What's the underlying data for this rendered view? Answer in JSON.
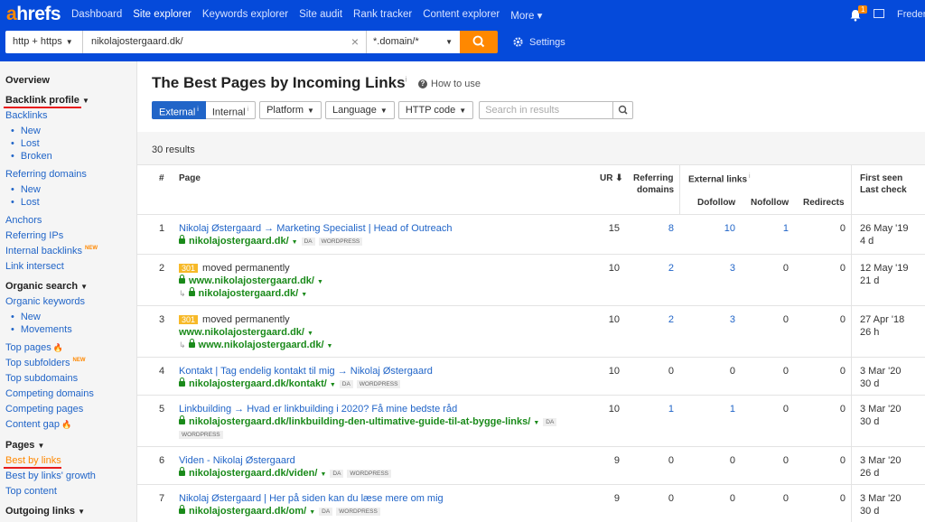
{
  "topbar": {
    "logo_a": "a",
    "logo_rest": "hrefs",
    "nav": [
      "Dashboard",
      "Site explorer",
      "Keywords explorer",
      "Site audit",
      "Rank tracker",
      "Content explorer",
      "More ▾"
    ],
    "active_nav": "Site explorer",
    "notif_count": "1",
    "user": "Freder",
    "protocol": "http + https",
    "target": "nikolajostergaard.dk/",
    "mode": "*.domain/*",
    "settings": "Settings",
    "accent": "#ff8800",
    "brand": "#054ada"
  },
  "sidebar": {
    "overview": "Overview",
    "backlink_profile": "Backlink profile",
    "backlinks": "Backlinks",
    "bl_new": "New",
    "bl_lost": "Lost",
    "bl_broken": "Broken",
    "referring_domains": "Referring domains",
    "rd_new": "New",
    "rd_lost": "Lost",
    "anchors": "Anchors",
    "referring_ips": "Referring IPs",
    "internal_backlinks": "Internal backlinks",
    "new_tag": "NEW",
    "link_intersect": "Link intersect",
    "organic_search": "Organic search",
    "organic_keywords": "Organic keywords",
    "ok_new": "New",
    "ok_movements": "Movements",
    "top_pages": "Top pages",
    "top_subfolders": "Top subfolders",
    "top_subdomains": "Top subdomains",
    "competing_domains": "Competing domains",
    "competing_pages": "Competing pages",
    "content_gap": "Content gap",
    "pages": "Pages",
    "best_by_links": "Best by links",
    "best_by_links_growth": "Best by links' growth",
    "top_content": "Top content",
    "outgoing_links": "Outgoing links"
  },
  "main": {
    "title": "The Best Pages by Incoming Links",
    "info_mark": "i",
    "how_to_use": "How to use",
    "filters": {
      "external": "External",
      "internal": "Internal",
      "platform": "Platform",
      "language": "Language",
      "http_code": "HTTP code",
      "search_placeholder": "Search in results"
    },
    "results_count": "30 results",
    "columns": {
      "index": "#",
      "page": "Page",
      "ur": "UR",
      "referring": "Referring",
      "domains": "domains",
      "external_links": "External links",
      "dofollow": "Dofollow",
      "nofollow": "Nofollow",
      "redirects": "Redirects",
      "first_seen": "First seen",
      "last_check": "Last check"
    },
    "rows": [
      {
        "n": "1",
        "title": "Nikolaj Østergaard → Marketing Specialist | Head of Outreach",
        "url": "nikolajostergaard.dk/",
        "tags": [
          "DA",
          "WORDPRESS"
        ],
        "ur": "15",
        "rd": "8",
        "dofollow": "10",
        "nofollow": "1",
        "redirects": "0",
        "first": "26 May '19",
        "last": "4 d"
      },
      {
        "n": "2",
        "code": "301",
        "moved": "moved permanently",
        "url": "www.nikolajostergaard.dk/",
        "target": "nikolajostergaard.dk/",
        "ur": "10",
        "rd": "2",
        "dofollow": "3",
        "nofollow": "0",
        "redirects": "0",
        "first": "12 May '19",
        "last": "21 d"
      },
      {
        "n": "3",
        "code": "301",
        "moved": "moved permanently",
        "url": "www.nikolajostergaard.dk/",
        "target": "www.nikolajostergaard.dk/",
        "ur": "10",
        "rd": "2",
        "dofollow": "3",
        "nofollow": "0",
        "redirects": "0",
        "first": "27 Apr '18",
        "last": "26 h"
      },
      {
        "n": "4",
        "title": "Kontakt | Tag endelig kontakt til mig → Nikolaj Østergaard",
        "url": "nikolajostergaard.dk/kontakt/",
        "tags": [
          "DA",
          "WORDPRESS"
        ],
        "ur": "10",
        "rd": "0",
        "dofollow": "0",
        "nofollow": "0",
        "redirects": "0",
        "first": "3 Mar '20",
        "last": "30 d"
      },
      {
        "n": "5",
        "title": "Linkbuilding → Hvad er linkbuilding i 2020? Få mine bedste råd",
        "url": "nikolajostergaard.dk/linkbuilding-den-ultimative-guide-til-at-bygge-links/",
        "tags": [
          "DA",
          "WORDPRESS"
        ],
        "ur": "10",
        "rd": "1",
        "dofollow": "1",
        "nofollow": "0",
        "redirects": "0",
        "first": "3 Mar '20",
        "last": "30 d"
      },
      {
        "n": "6",
        "title": "Viden - Nikolaj Østergaard",
        "url": "nikolajostergaard.dk/viden/",
        "tags": [
          "DA",
          "WORDPRESS"
        ],
        "ur": "9",
        "rd": "0",
        "dofollow": "0",
        "nofollow": "0",
        "redirects": "0",
        "first": "3 Mar '20",
        "last": "26 d"
      },
      {
        "n": "7",
        "title": "Nikolaj Østergaard | Her på siden kan du læse mere om mig",
        "url": "nikolajostergaard.dk/om/",
        "tags": [
          "DA",
          "WORDPRESS"
        ],
        "ur": "9",
        "rd": "0",
        "dofollow": "0",
        "nofollow": "0",
        "redirects": "0",
        "first": "3 Mar '20",
        "last": "30 d"
      }
    ]
  }
}
